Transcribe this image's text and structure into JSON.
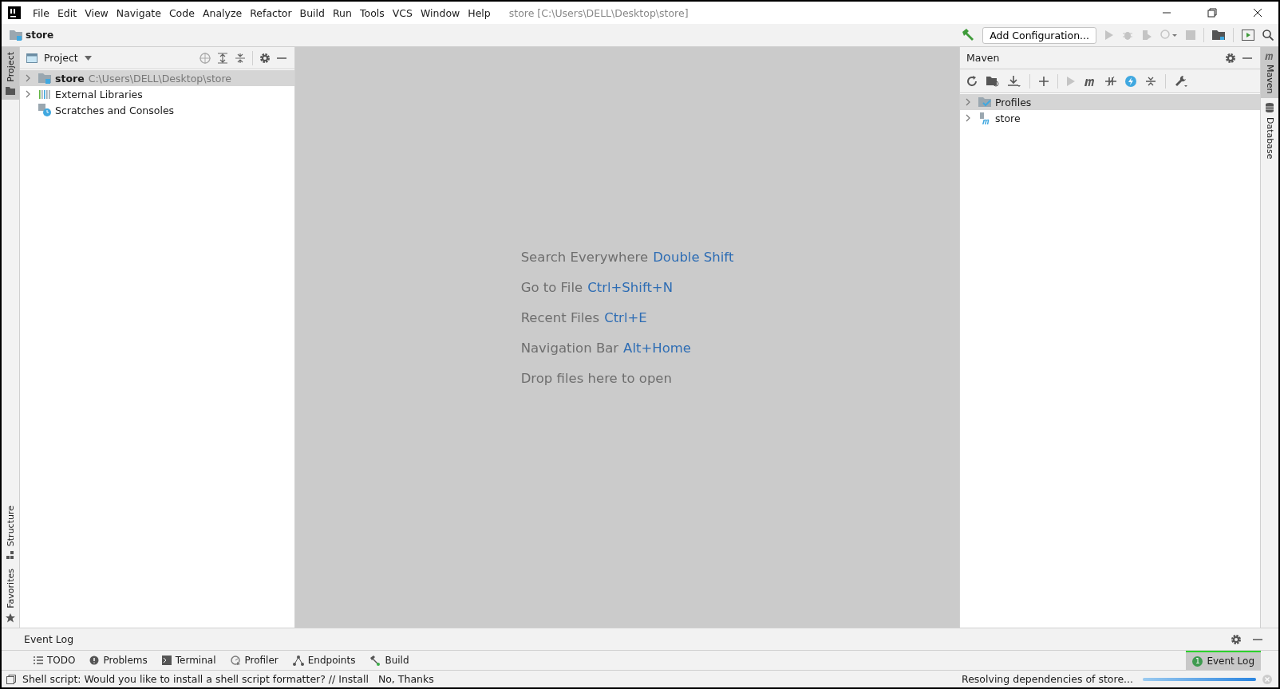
{
  "window": {
    "title": "store [C:\\Users\\DELL\\Desktop\\store]",
    "menu": [
      "File",
      "Edit",
      "View",
      "Navigate",
      "Code",
      "Analyze",
      "Refactor",
      "Build",
      "Run",
      "Tools",
      "VCS",
      "Window",
      "Help"
    ]
  },
  "navbar": {
    "breadcrumb": "store",
    "run_config": "Add Configuration..."
  },
  "left_stripe": [
    {
      "label": "Project",
      "selected": true,
      "kind": "project"
    },
    {
      "label": "Structure",
      "selected": false,
      "kind": "structure"
    },
    {
      "label": "Favorites",
      "selected": false,
      "kind": "favorites"
    }
  ],
  "project_panel": {
    "title": "Project",
    "tree": [
      {
        "name": "store",
        "path": "C:\\Users\\DELL\\Desktop\\store",
        "kind": "module",
        "selected": true,
        "expanded": false
      },
      {
        "name": "External Libraries",
        "kind": "library",
        "selected": false,
        "expanded": false
      },
      {
        "name": "Scratches and Consoles",
        "kind": "scratches",
        "selected": false
      }
    ]
  },
  "editor_hints": [
    {
      "action": "Search Everywhere",
      "shortcut": "Double Shift"
    },
    {
      "action": "Go to File",
      "shortcut": "Ctrl+Shift+N"
    },
    {
      "action": "Recent Files",
      "shortcut": "Ctrl+E"
    },
    {
      "action": "Navigation Bar",
      "shortcut": "Alt+Home"
    },
    {
      "action": "Drop files here to open"
    }
  ],
  "maven_panel": {
    "title": "Maven",
    "tree": [
      {
        "name": "Profiles",
        "kind": "profiles",
        "selected": true,
        "expanded": false
      },
      {
        "name": "store",
        "kind": "module",
        "selected": false,
        "expanded": false
      }
    ]
  },
  "right_stripe": [
    {
      "label": "Maven",
      "selected": true,
      "kind": "maven"
    },
    {
      "label": "Database",
      "selected": false,
      "kind": "database"
    }
  ],
  "event_log_panel": {
    "title": "Event Log"
  },
  "tool_tabs": [
    {
      "label": "TODO",
      "kind": "todo",
      "selected": false
    },
    {
      "label": "Problems",
      "kind": "problems",
      "selected": false
    },
    {
      "label": "Terminal",
      "kind": "terminal",
      "selected": false
    },
    {
      "label": "Profiler",
      "kind": "profiler",
      "selected": false
    },
    {
      "label": "Endpoints",
      "kind": "endpoints",
      "selected": false
    },
    {
      "label": "Build",
      "kind": "build",
      "selected": false
    }
  ],
  "event_log_tab": {
    "label": "Event Log",
    "badge": "1",
    "selected": true
  },
  "status_bar": {
    "message": "Shell script: Would you like to install a shell script formatter? // Install",
    "action": "No, Thanks",
    "progress_text": "Resolving dependencies of store...",
    "level": 1
  }
}
